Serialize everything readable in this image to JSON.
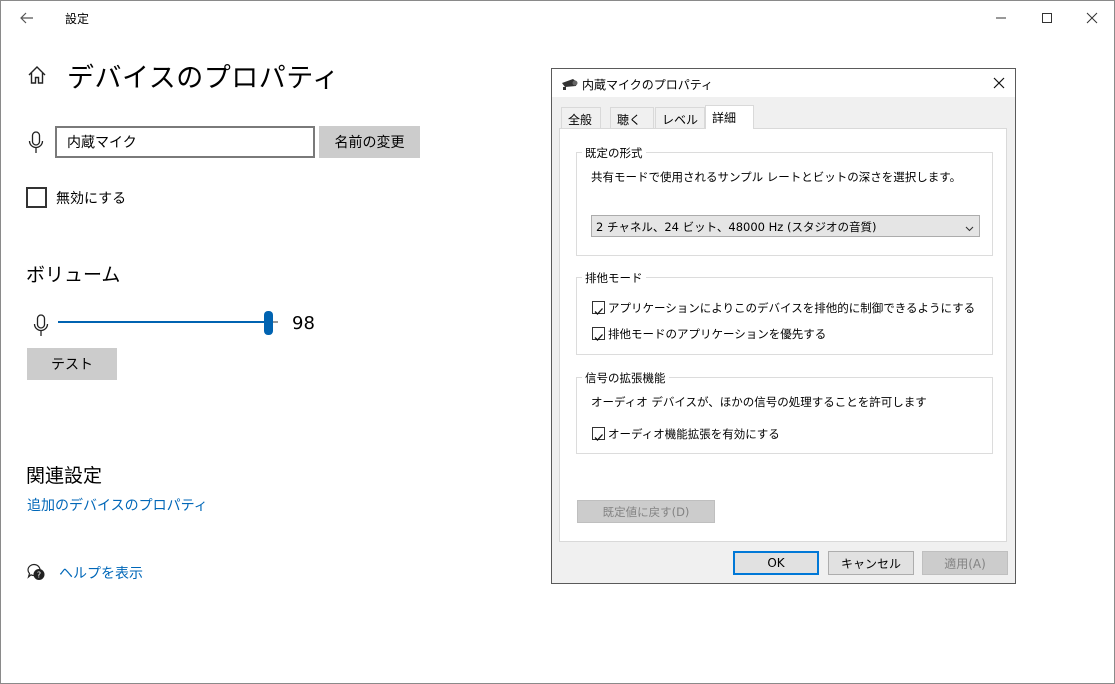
{
  "window": {
    "title": "設定",
    "back_icon": "arrow-left-icon",
    "caption_buttons": [
      "minimize-icon",
      "maximize-icon",
      "close-icon"
    ]
  },
  "page": {
    "title": "デバイスのプロパティ",
    "device_name_value": "内蔵マイク",
    "rename_button": "名前の変更",
    "disable_checkbox": {
      "label": "無効にする",
      "checked": false
    },
    "volume": {
      "heading": "ボリューム",
      "value": "98",
      "level_percent": 98
    },
    "test_button": "テスト",
    "related": {
      "heading": "関連設定",
      "link": "追加のデバイスのプロパティ"
    },
    "help_link": "ヘルプを表示"
  },
  "dialog": {
    "title": "内蔵マイクのプロパティ",
    "tabs": [
      "全般",
      "聴く",
      "レベル",
      "詳細"
    ],
    "active_tab": "詳細",
    "default_format": {
      "group_label": "既定の形式",
      "description": "共有モードで使用されるサンプル レートとビットの深さを選択します。",
      "selected": "2 チャネル、24 ビット、48000 Hz (スタジオの音質)"
    },
    "exclusive_mode": {
      "group_label": "排他モード",
      "options": [
        {
          "label": "アプリケーションによりこのデバイスを排他的に制御できるようにする",
          "checked": true
        },
        {
          "label": "排他モードのアプリケーションを優先する",
          "checked": true
        }
      ]
    },
    "signal_enhancements": {
      "group_label": "信号の拡張機能",
      "description": "オーディオ デバイスが、ほかの信号の処理することを許可します",
      "option": {
        "label": "オーディオ機能拡張を有効にする",
        "checked": true
      }
    },
    "reset_button": "既定値に戻す(D)",
    "ok_button": "OK",
    "cancel_button": "キャンセル",
    "apply_button": "適用(A)"
  },
  "colors": {
    "accent": "#0063b1",
    "link": "#0067b8",
    "button_gray": "#cccccc",
    "dialog_bg": "#f0f0f0"
  }
}
